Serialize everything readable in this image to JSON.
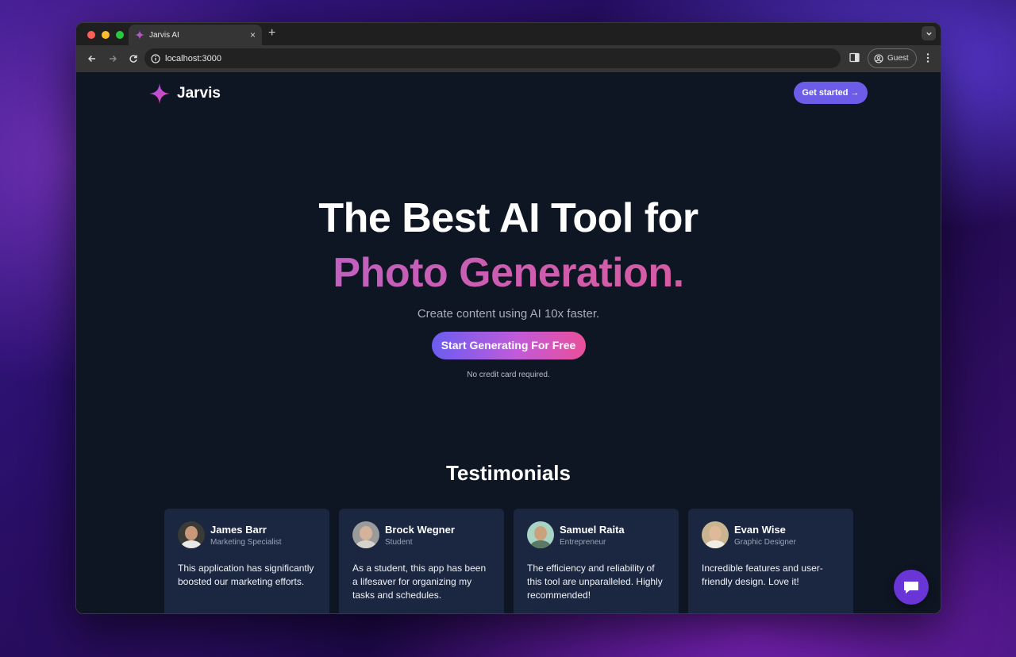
{
  "browser": {
    "tab_title": "Jarvis AI",
    "tab_close": "×",
    "new_tab": "+",
    "url": "localhost:3000",
    "profile_label": "Guest"
  },
  "nav": {
    "brand": "Jarvis",
    "cta": "Get started →"
  },
  "hero": {
    "line1": "The Best AI Tool for",
    "line2": "Photo Generation.",
    "subtitle": "Create content using AI 10x faster.",
    "button": "Start Generating For Free",
    "note": "No credit card required."
  },
  "testimonials": {
    "title": "Testimonials",
    "items": [
      {
        "name": "James Barr",
        "role": "Marketing Specialist",
        "text": "This application has significantly boosted our marketing efforts."
      },
      {
        "name": "Brock Wegner",
        "role": "Student",
        "text": "As a student, this app has been a lifesaver for organizing my tasks and schedules."
      },
      {
        "name": "Samuel Raita",
        "role": "Entrepreneur",
        "text": "The efficiency and reliability of this tool are unparalleled. Highly recommended!"
      },
      {
        "name": "Evan Wise",
        "role": "Graphic Designer",
        "text": "Incredible features and user-friendly design. Love it!"
      }
    ]
  },
  "colors": {
    "accent": "#6d5ce8",
    "page_bg": "#0f1623",
    "card_bg": "#1b2740",
    "chat": "#6a35d6"
  },
  "icons": [
    "back-icon",
    "forward-icon",
    "reload-icon",
    "site-info-icon",
    "side-panel-icon",
    "profile-icon",
    "kebab-menu-icon",
    "sparkle-logo-icon",
    "chat-icon"
  ]
}
